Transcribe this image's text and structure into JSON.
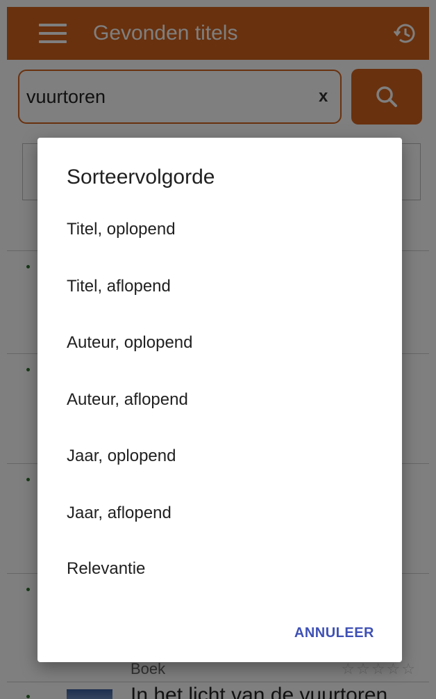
{
  "appbar": {
    "title": "Gevonden titels",
    "menu_icon": "hamburger-icon",
    "history_icon": "history-icon"
  },
  "search": {
    "value": "vuurtoren",
    "clear_label": "x",
    "search_icon": "search-icon"
  },
  "results": [
    {
      "type": "Boek",
      "stars": "☆☆☆☆☆"
    },
    {
      "title": "In het licht van de vuurtoren"
    }
  ],
  "dialog": {
    "title": "Sorteervolgorde",
    "options": [
      "Titel, oplopend",
      "Titel, aflopend",
      "Auteur, oplopend",
      "Auteur, aflopend",
      "Jaar, oplopend",
      "Jaar, aflopend",
      "Relevantie"
    ],
    "cancel_label": "ANNULEER"
  },
  "colors": {
    "accent": "#d2621c",
    "dialog_button": "#3f51b5"
  }
}
